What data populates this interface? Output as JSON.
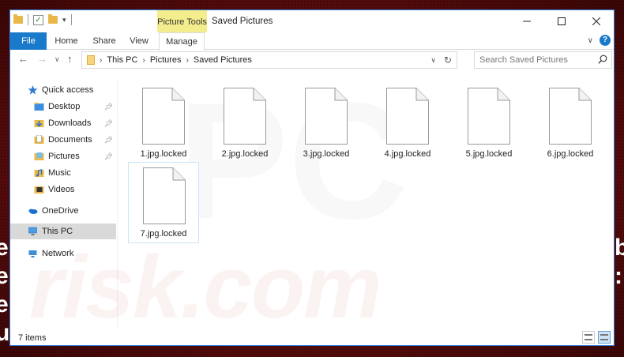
{
  "window": {
    "title": "Saved Pictures",
    "context_tab_group": "Picture Tools",
    "controls": {
      "minimize": "—",
      "maximize": "☐",
      "close": "✕"
    }
  },
  "ribbon": {
    "tabs": [
      {
        "label": "File"
      },
      {
        "label": "Home"
      },
      {
        "label": "Share"
      },
      {
        "label": "View"
      },
      {
        "label": "Manage"
      }
    ],
    "help": "?"
  },
  "address": {
    "crumbs": [
      "This PC",
      "Pictures",
      "Saved Pictures"
    ]
  },
  "search": {
    "placeholder": "Search Saved Pictures"
  },
  "nav_pane": {
    "quick_access": "Quick access",
    "items": [
      {
        "label": "Desktop",
        "pinned": true
      },
      {
        "label": "Downloads",
        "pinned": true
      },
      {
        "label": "Documents",
        "pinned": true
      },
      {
        "label": "Pictures",
        "pinned": true
      },
      {
        "label": "Music",
        "pinned": false
      },
      {
        "label": "Videos",
        "pinned": false
      }
    ],
    "onedrive": "OneDrive",
    "this_pc": "This PC",
    "network": "Network"
  },
  "files": [
    {
      "name": "1.jpg.locked"
    },
    {
      "name": "2.jpg.locked"
    },
    {
      "name": "3.jpg.locked"
    },
    {
      "name": "4.jpg.locked"
    },
    {
      "name": "5.jpg.locked"
    },
    {
      "name": "6.jpg.locked"
    },
    {
      "name": "7.jpg.locked"
    }
  ],
  "status": {
    "count": "7 items"
  },
  "watermark": {
    "text": "risk.com",
    "pc": "PC"
  },
  "background_text": {
    "left": "er\ner\ne\nu",
    "right": "b\n:\n\n"
  }
}
